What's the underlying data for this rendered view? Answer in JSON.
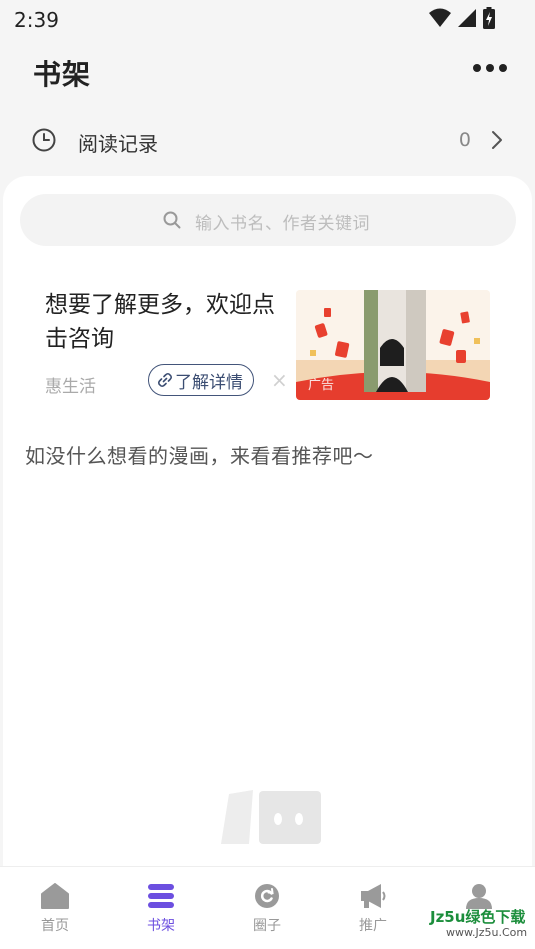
{
  "status": {
    "time": "2:39"
  },
  "header": {
    "title": "书架"
  },
  "history": {
    "label": "阅读记录",
    "count": "0"
  },
  "search": {
    "placeholder": "输入书名、作者关键词"
  },
  "ad": {
    "title": "想要了解更多，欢迎点击咨询",
    "source": "惠生活",
    "cta": "了解详情",
    "close": "×",
    "tag": "广告"
  },
  "recommend_text": "如没什么想看的漫画，来看看推荐吧～",
  "tabs": [
    {
      "label": "首页",
      "icon": "home-icon",
      "active": false
    },
    {
      "label": "书架",
      "icon": "bookshelf-icon",
      "active": true
    },
    {
      "label": "圈子",
      "icon": "circle-icon",
      "active": false
    },
    {
      "label": "推广",
      "icon": "megaphone-icon",
      "active": false
    },
    {
      "label": "我的",
      "icon": "profile-icon",
      "active": false
    }
  ],
  "watermark": {
    "main": "Jz5u绿色下载",
    "sub": "www.Jz5u.Com"
  },
  "colors": {
    "accent": "#6c4fe0",
    "background": "#f5f5f5",
    "card": "#ffffff",
    "button_border": "#43557a"
  }
}
